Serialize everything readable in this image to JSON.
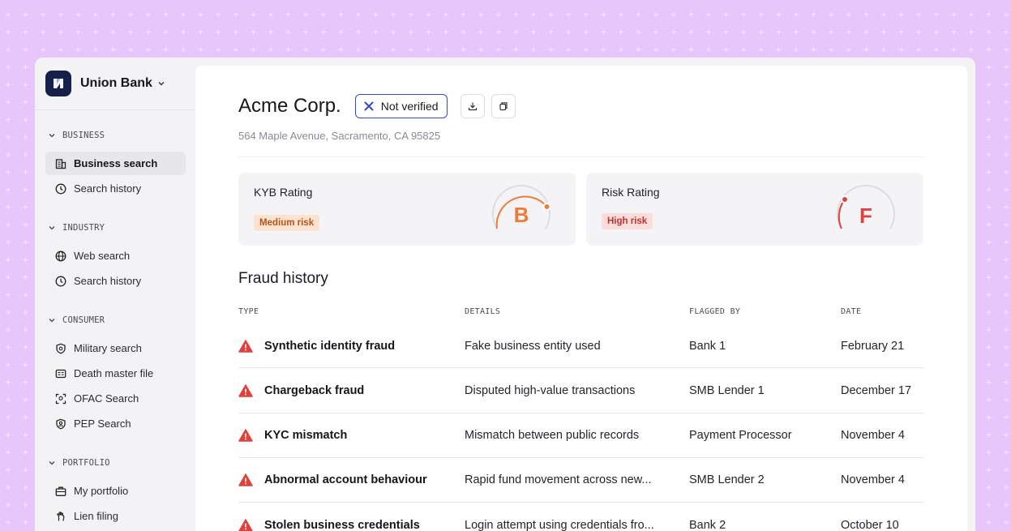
{
  "app": {
    "bank_name": "Union Bank"
  },
  "sidebar": {
    "sections": [
      {
        "title": "BUSINESS",
        "items": [
          {
            "label": "Business search",
            "icon": "building-icon",
            "active": true
          },
          {
            "label": "Search history",
            "icon": "clock-icon",
            "active": false
          }
        ]
      },
      {
        "title": "INDUSTRY",
        "items": [
          {
            "label": "Web search",
            "icon": "globe-icon",
            "active": false
          },
          {
            "label": "Search history",
            "icon": "clock-icon",
            "active": false
          }
        ]
      },
      {
        "title": "CONSUMER",
        "items": [
          {
            "label": "Military search",
            "icon": "shield-icon",
            "active": false
          },
          {
            "label": "Death master file",
            "icon": "id-card-icon",
            "active": false
          },
          {
            "label": "OFAC Search",
            "icon": "scan-icon",
            "active": false
          },
          {
            "label": "PEP Search",
            "icon": "badge-icon",
            "active": false
          }
        ]
      },
      {
        "title": "PORTFOLIO",
        "items": [
          {
            "label": "My portfolio",
            "icon": "briefcase-icon",
            "active": false
          },
          {
            "label": "Lien filing",
            "icon": "hand-icon",
            "active": false
          }
        ]
      }
    ]
  },
  "company": {
    "name": "Acme Corp.",
    "verification_label": "Not verified",
    "address": "564 Maple Avenue, Sacramento, CA 95825"
  },
  "ratings": {
    "kyb": {
      "title": "KYB Rating",
      "grade": "B",
      "risk_label": "Medium risk",
      "color": "#f07a3a"
    },
    "risk": {
      "title": "Risk Rating",
      "grade": "F",
      "risk_label": "High risk",
      "color": "#e0413b"
    }
  },
  "fraud_history": {
    "title": "Fraud history",
    "columns": {
      "type": "TYPE",
      "details": "DETAILS",
      "flagged_by": "FLAGGED BY",
      "date": "DATE"
    },
    "rows": [
      {
        "type": "Synthetic identity fraud",
        "details": "Fake business entity used",
        "flagged_by": "Bank 1",
        "date": "February 21"
      },
      {
        "type": "Chargeback fraud",
        "details": "Disputed high-value transactions",
        "flagged_by": "SMB Lender 1",
        "date": "December 17"
      },
      {
        "type": "KYC mismatch",
        "details": "Mismatch between public records",
        "flagged_by": "Payment Processor",
        "date": "November 4"
      },
      {
        "type": "Abnormal account behaviour",
        "details": "Rapid fund movement across new...",
        "flagged_by": "SMB Lender 2",
        "date": "November 4"
      },
      {
        "type": "Stolen business credentials",
        "details": "Login attempt using credentials fro...",
        "flagged_by": "Bank 2",
        "date": "October 10"
      }
    ]
  },
  "colors": {
    "accent_blue": "#2e4bd0",
    "warning_red": "#e0413b",
    "background_purple": "#e8c6fb"
  }
}
